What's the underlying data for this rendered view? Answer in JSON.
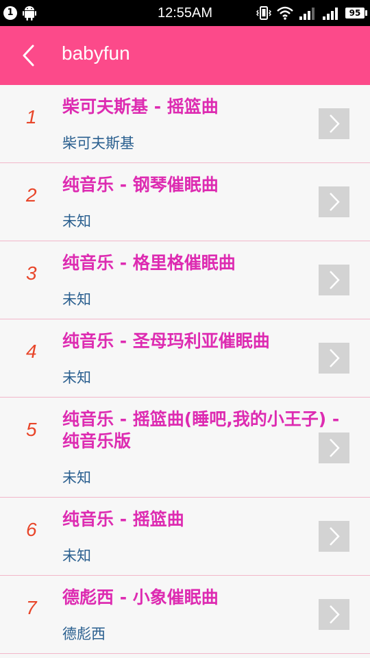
{
  "status_bar": {
    "notification_count": "1",
    "time": "12:55AM",
    "battery": "95",
    "icons": [
      "android-icon",
      "vibrate-icon",
      "wifi-icon",
      "signal-icon",
      "signal-2-icon",
      "battery-icon"
    ]
  },
  "app_bar": {
    "title": "babyfun",
    "background": "#fc4a8a",
    "back_icon": "chevron-left-icon"
  },
  "songs": [
    {
      "num": "1",
      "title": "柴可夫斯基 - 摇篮曲",
      "artist": "柴可夫斯基"
    },
    {
      "num": "2",
      "title": "纯音乐 - 钢琴催眠曲",
      "artist": "未知"
    },
    {
      "num": "3",
      "title": "纯音乐 - 格里格催眠曲",
      "artist": "未知"
    },
    {
      "num": "4",
      "title": "纯音乐 - 圣母玛利亚催眠曲",
      "artist": "未知"
    },
    {
      "num": "5",
      "title": "纯音乐 - 摇篮曲(睡吧,我的小王子) - 纯音乐版",
      "artist": "未知"
    },
    {
      "num": "6",
      "title": "纯音乐 - 摇篮曲",
      "artist": "未知"
    },
    {
      "num": "7",
      "title": "德彪西 - 小象催眠曲",
      "artist": "德彪西"
    }
  ],
  "colors": {
    "title": "#dd2bb1",
    "artist": "#2a5f8f",
    "number": "#e8462a",
    "divider": "#f2b6c9"
  }
}
